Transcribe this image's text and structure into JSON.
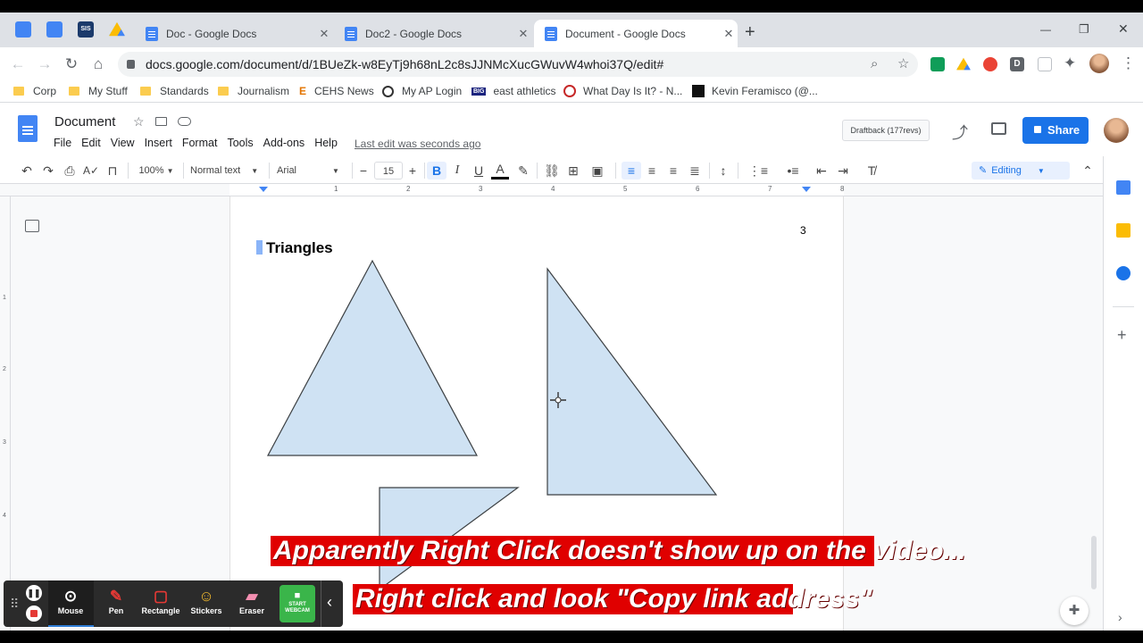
{
  "browser": {
    "tabs": [
      {
        "label": "Doc - Google Docs",
        "close": "✕"
      },
      {
        "label": "Doc2 - Google Docs",
        "close": "✕"
      },
      {
        "label": "Document - Google Docs",
        "close": "✕",
        "active": true
      }
    ],
    "pinned_sis_label": "SIS",
    "new_tab": "+",
    "url": "docs.google.com/document/d/1BUeZk-w8EyTj9h68nL2c8sJJNMcXucGWuvW4whoi37Q/edit#",
    "window_controls": {
      "minimize": "—",
      "restore": "❐",
      "close": "✕"
    },
    "extension_d_label": "D"
  },
  "bookmarks": [
    {
      "label": "Corp",
      "icon": "folder-icon"
    },
    {
      "label": "My Stuff",
      "icon": "folder-icon"
    },
    {
      "label": "Standards",
      "icon": "folder-icon"
    },
    {
      "label": "Journalism",
      "icon": "folder-icon"
    },
    {
      "label": "CEHS News",
      "icon": "e-icon"
    },
    {
      "label": "My AP Login",
      "icon": "ap-icon"
    },
    {
      "label": "east athletics",
      "icon": "big-icon"
    },
    {
      "label": "What Day Is It? - N...",
      "icon": "wd-icon"
    },
    {
      "label": "Kevin Feramisco (@...",
      "icon": "twitter-icon"
    }
  ],
  "bookmark_glyphs": {
    "e": "E",
    "big": "BIG"
  },
  "docs": {
    "title": "Document",
    "menu": [
      "File",
      "Edit",
      "View",
      "Insert",
      "Format",
      "Tools",
      "Add-ons",
      "Help"
    ],
    "last_edit": "Last edit was seconds ago",
    "draftback": "Draftback (177revs)",
    "share": "Share"
  },
  "toolbar": {
    "zoom": "100%",
    "style": "Normal text",
    "font": "Arial",
    "font_size": "15",
    "minus": "−",
    "plus": "+",
    "bold": "B",
    "italic": "I",
    "underline": "U",
    "text_color": "A",
    "mode": "Editing"
  },
  "ruler": {
    "ticks": [
      "1",
      "2",
      "3",
      "4",
      "5",
      "6",
      "7",
      "8"
    ]
  },
  "vruler": {
    "ticks": [
      "1",
      "2",
      "3",
      "4"
    ]
  },
  "page": {
    "heading": "Triangles",
    "page_number": "3",
    "shape_fill": "#cfe2f3",
    "shape_stroke": "#3c4043"
  },
  "captions": {
    "line1": "Apparently Right Click doesn't show up on the video...",
    "line2": "Right click and look \"Copy link address\""
  },
  "recorder": {
    "tools": [
      {
        "label": "Mouse",
        "icon": "mouse-icon"
      },
      {
        "label": "Pen",
        "icon": "pen-icon"
      },
      {
        "label": "Rectangle",
        "icon": "rectangle-icon"
      },
      {
        "label": "Stickers",
        "icon": "sticker-icon"
      },
      {
        "label": "Eraser",
        "icon": "eraser-icon"
      }
    ],
    "webcam_label_1": "START",
    "webcam_label_2": "WEBCAM"
  },
  "colors": {
    "brand_blue": "#1a73e8",
    "caption_red": "#e00000",
    "recorder_green": "#3ab54a"
  }
}
